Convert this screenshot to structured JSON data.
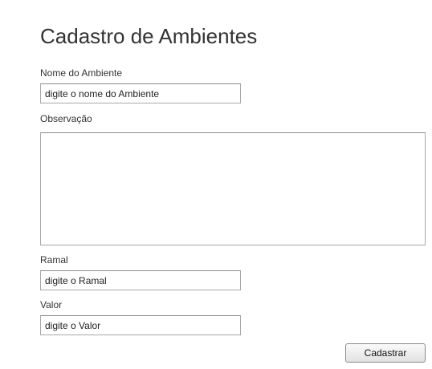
{
  "form": {
    "title": "Cadastro de Ambientes",
    "nome": {
      "label": "Nome do Ambiente",
      "value": "digite o nome do Ambiente"
    },
    "observacao": {
      "label": "Observação",
      "value": ""
    },
    "ramal": {
      "label": "Ramal",
      "value": "digite o Ramal"
    },
    "valor": {
      "label": "Valor",
      "value": "digite o Valor"
    },
    "submit_label": "Cadastrar"
  }
}
